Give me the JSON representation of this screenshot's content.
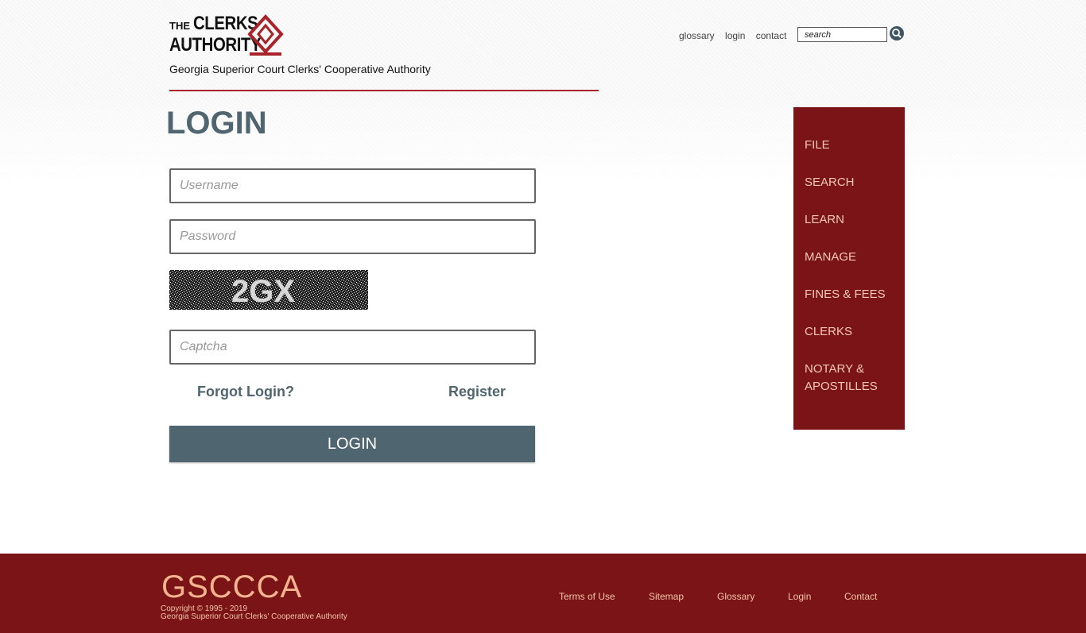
{
  "header": {
    "logo_the": "THE",
    "logo_line1": "CLERKS",
    "logo_line2": "AUTHORITY",
    "subtitle": "Georgia Superior Court Clerks' Cooperative Authority",
    "top_links": [
      "glossary",
      "login",
      "contact"
    ],
    "search_placeholder": "search",
    "search_icon": "search-icon"
  },
  "main": {
    "title": "LOGIN",
    "username_placeholder": "Username",
    "password_placeholder": "Password",
    "captcha_text": "2GX",
    "captcha_placeholder": "Captcha",
    "forgot_label": "Forgot Login?",
    "register_label": "Register",
    "login_button": "LOGIN"
  },
  "sidebar": {
    "items": [
      "FILE",
      "SEARCH",
      "LEARN",
      "MANAGE",
      "FINES & FEES",
      "CLERKS",
      "NOTARY & APOSTILLES"
    ]
  },
  "footer": {
    "brand": "GSCCCA",
    "copyright": "Copyright © 1995 - 2019",
    "org": "Georgia Superior Court Clerks' Cooperative Authority",
    "links": [
      "Terms of Use",
      "Sitemap",
      "Glossary",
      "Login",
      "Contact"
    ]
  },
  "colors": {
    "accent_red": "#7a1417",
    "slate": "#4f6570",
    "rule_red": "#a8232a"
  }
}
